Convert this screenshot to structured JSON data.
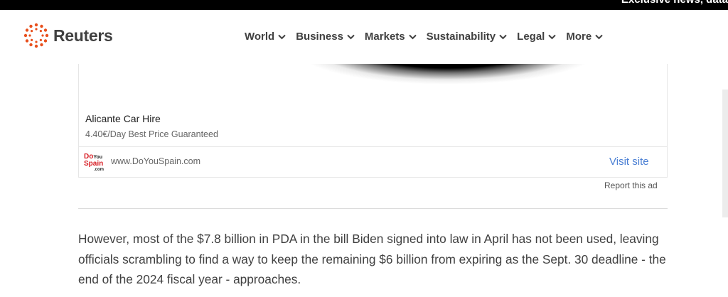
{
  "topbar": {
    "text": "Exclusive news, data"
  },
  "header": {
    "logo_text": "Reuters",
    "nav": [
      {
        "label": "World"
      },
      {
        "label": "Business"
      },
      {
        "label": "Markets"
      },
      {
        "label": "Sustainability"
      },
      {
        "label": "Legal"
      },
      {
        "label": "More"
      }
    ]
  },
  "ad": {
    "title": "Alicante Car Hire",
    "description": "4.40€/Day Best Price Guaranteed",
    "logo_line1": "Do",
    "logo_line1b": "You",
    "logo_line2": "Spain",
    "logo_line3": ".com",
    "url": "www.DoYouSpain.com",
    "cta": "Visit site",
    "report": "Report this ad"
  },
  "article": {
    "paragraph": "However, most of the $7.8 billion in PDA in the bill Biden signed into law in April has not been used, leaving officials scrambling to find a way to keep the remaining $6 billion from expiring as the Sept. 30 deadline - the end of the 2024 fiscal year - approaches."
  },
  "colors": {
    "brand_orange": "#e8501d",
    "link_blue": "#4a7fd4",
    "text": "#404040"
  }
}
